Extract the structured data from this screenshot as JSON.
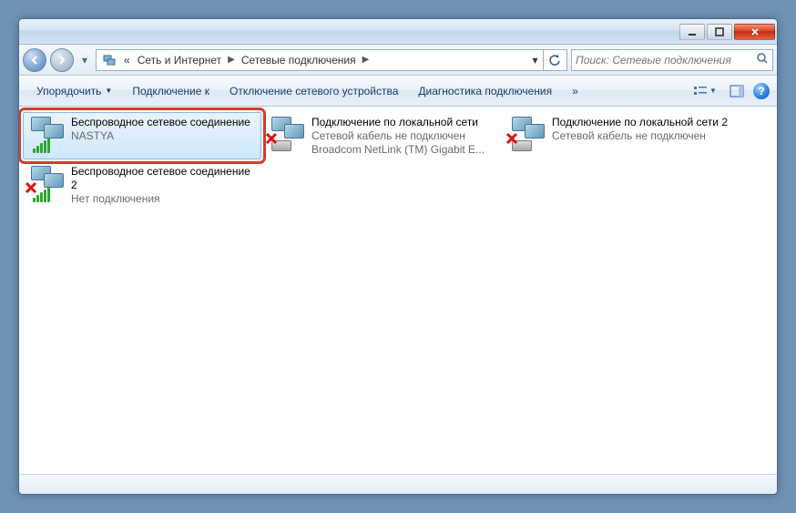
{
  "breadcrumb": {
    "sep0": "«",
    "part1": "Сеть и Интернет",
    "part2": "Сетевые подключения"
  },
  "search": {
    "placeholder": "Поиск: Сетевые подключения"
  },
  "toolbar": {
    "organize": "Упорядочить",
    "connect": "Подключение к",
    "disable": "Отключение сетевого устройства",
    "diagnose": "Диагностика подключения"
  },
  "connections": [
    {
      "name": "Беспроводное сетевое соединение",
      "sub1": "NASTYA",
      "sub2": ""
    },
    {
      "name": "Подключение по локальной сети",
      "sub1": "Сетевой кабель не подключен",
      "sub2": "Broadcom NetLink (TM) Gigabit E..."
    },
    {
      "name": "Подключение по локальной сети 2",
      "sub1": "Сетевой кабель не подключен",
      "sub2": ""
    },
    {
      "name": "Беспроводное сетевое соединение 2",
      "sub1": "Нет подключения",
      "sub2": ""
    }
  ]
}
